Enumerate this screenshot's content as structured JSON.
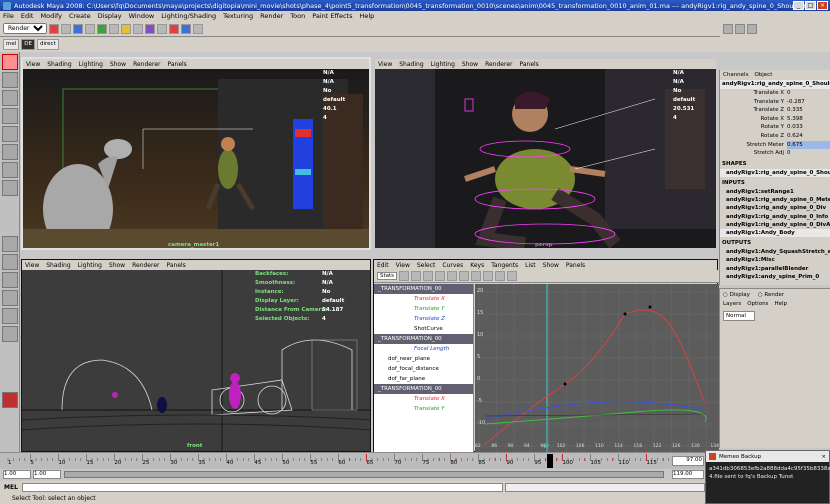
{
  "window": {
    "title": "Autodesk Maya 2008: C:\\Users\\fq\\Documents\\maya\\projects\\digitopia\\mini_movie\\shots\\phase_4\\point5_transformation\\0045_transformation_0010\\scenes\\anim\\0045_transformation_0010_anim_01.ma   ---   andyRigv1:rig_andy_spine_0_Shoulders..."
  },
  "menu": [
    "File",
    "Edit",
    "Modify",
    "Create",
    "Display",
    "Window",
    "Lighting/Shading",
    "Texturing",
    "Render",
    "Toon",
    "Paint Effects",
    "Help"
  ],
  "shelf": {
    "mode": "Rendering",
    "tabs": [
      "mel",
      "DE",
      "direct"
    ]
  },
  "viewport_menu": [
    "View",
    "Shading",
    "Lighting",
    "Show",
    "Renderer",
    "Panels"
  ],
  "vp1": {
    "hud": [
      "N/A",
      "N/A",
      "No",
      "",
      "default",
      "40.1",
      "4"
    ],
    "camera": "camera_master1"
  },
  "vp2": {
    "hud": [
      "N/A",
      "N/A",
      "No",
      "",
      "default",
      "20.531",
      "4"
    ],
    "label": "persp"
  },
  "vp3": {
    "labels": [
      "Backfaces:",
      "Smoothness:",
      "Instance:",
      "Display Layer:",
      "Distance From Camera:",
      "Selected Objects:"
    ],
    "values": [
      "N/A",
      "N/A",
      "No",
      "default",
      "54.187",
      "4"
    ],
    "camera": "front"
  },
  "graph_editor": {
    "menu": [
      "Edit",
      "View",
      "Select",
      "Curves",
      "Keys",
      "Tangents",
      "List",
      "Show",
      "Panels"
    ],
    "stats": "Stats",
    "outliner": [
      {
        "label": "_TRANSFORMATION_00",
        "cls": "head"
      },
      {
        "label": "Translate X",
        "cls": "red"
      },
      {
        "label": "Translate Y",
        "cls": "green"
      },
      {
        "label": "Translate Z",
        "cls": "blue"
      },
      {
        "label": "ShotCurve",
        "cls": "plain"
      },
      {
        "label": "_TRANSFORMATION_00",
        "cls": "head"
      },
      {
        "label": "Focal Length",
        "cls": "blue"
      },
      {
        "label": "dof_near_plane",
        "cls": "plain"
      },
      {
        "label": "dof_focal_distance",
        "cls": "plain"
      },
      {
        "label": "dof_far_plane",
        "cls": "plain"
      },
      {
        "label": "_TRANSFORMATION_00",
        "cls": "head"
      },
      {
        "label": "Translate X",
        "cls": "red"
      },
      {
        "label": "Translate Y",
        "cls": "green"
      }
    ],
    "yticks": [
      "20",
      "15",
      "10",
      "5",
      "0",
      "-5",
      "-10"
    ],
    "xticks": [
      "82",
      "86",
      "90",
      "94",
      "98",
      "102",
      "106",
      "110",
      "114",
      "118",
      "122",
      "126",
      "130",
      "134"
    ],
    "current_frame": "97"
  },
  "channelbox": {
    "tabs": [
      "Channels",
      "Object"
    ],
    "node": "andyRigv1:rig_andy_spine_0_Should",
    "attrs": [
      {
        "n": "Translate X",
        "v": "0"
      },
      {
        "n": "Translate Y",
        "v": "-0.287"
      },
      {
        "n": "Translate Z",
        "v": "0.335"
      },
      {
        "n": "Rotate X",
        "v": "5.398"
      },
      {
        "n": "Rotate Y",
        "v": "0.033"
      },
      {
        "n": "Rotate Z",
        "v": "0.624"
      },
      {
        "n": "Stretch Meter",
        "v": "0.675"
      },
      {
        "n": "Stretch Adj",
        "v": "0"
      }
    ],
    "shapes_h": "SHAPES",
    "shapes": [
      "andyRigv1:rig_andy_spine_0_Shoul"
    ],
    "inputs_h": "INPUTS",
    "inputs": [
      "andyRigv1:setRange1",
      "andyRigv1:rig_andy_spine_0_Meter",
      "andyRigv1:rig_andy_spine_0_Div",
      "andyRigv1:rig_andy_spine_0_Info",
      "andyRigv1:rig_andy_spine_0_DivA",
      "andyRigv1:Andy_Body"
    ],
    "outputs_h": "OUTPUTS",
    "outputs": [
      "andyRigv1:Andy_SquashStretch_ad",
      "andyRigv1:Misc",
      "andyRigv1:parallelBlender",
      "andyRigv1:andy_spine_Prim_0"
    ]
  },
  "layers": {
    "radio_display": "Display",
    "radio_render": "Render",
    "menu": [
      "Layers",
      "Options",
      "Help"
    ],
    "mode": "Normal"
  },
  "timeline": {
    "ticks": [
      "1",
      "5",
      "10",
      "15",
      "20",
      "25",
      "30",
      "35",
      "40",
      "45",
      "50",
      "55",
      "60",
      "65",
      "70",
      "75",
      "80",
      "85",
      "90",
      "95",
      "100",
      "105",
      "110",
      "115"
    ],
    "current": "97.00"
  },
  "range": {
    "start": "1.00",
    "inner_start": "1.00",
    "inner_end": "119.00",
    "end": "119.00"
  },
  "mel": {
    "label": "MEL"
  },
  "help": "Select Tool: select an object",
  "notify": {
    "title": "Memeo Backup",
    "line1": "a341db306853efb2a888dda4c95f35b8338ab5",
    "line2": "4.file sent to fq's Backup Tunst"
  }
}
